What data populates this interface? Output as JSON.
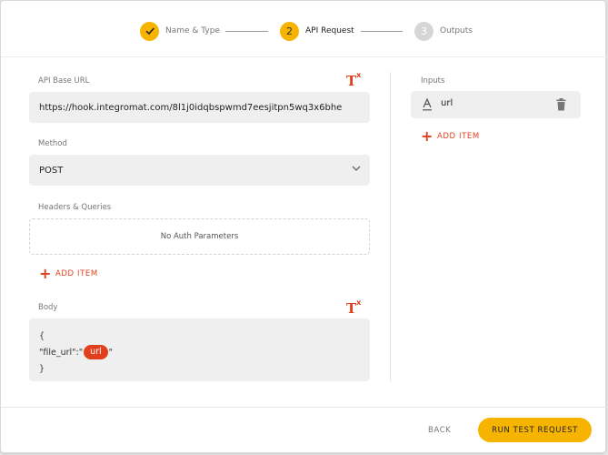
{
  "stepper": {
    "steps": [
      {
        "number": "",
        "label": "Name & Type",
        "state": "done"
      },
      {
        "number": "2",
        "label": "API Request",
        "state": "active"
      },
      {
        "number": "3",
        "label": "Outputs",
        "state": "pending"
      }
    ]
  },
  "api_base_url": {
    "label": "API Base URL",
    "value": "https://hook.integromat.com/8l1j0idqbspwmd7eesjitpn5wq3x6bhe"
  },
  "method": {
    "label": "Method",
    "value": "POST"
  },
  "headers": {
    "label": "Headers & Queries",
    "empty_text": "No Auth Parameters",
    "add_label": "ADD ITEM"
  },
  "body": {
    "label": "Body",
    "line1": "{",
    "line2_prefix": "\"file_url\":\"",
    "line2_token": "url",
    "line2_suffix": "\"",
    "line3": "}"
  },
  "inputs": {
    "label": "Inputs",
    "items": [
      {
        "name": "url",
        "type_icon": "text-type-icon"
      }
    ],
    "add_label": "ADD ITEM"
  },
  "footer": {
    "back_label": "BACK",
    "run_label": "RUN TEST REQUEST"
  },
  "colors": {
    "accent": "#f6b400",
    "danger": "#e2401c"
  }
}
